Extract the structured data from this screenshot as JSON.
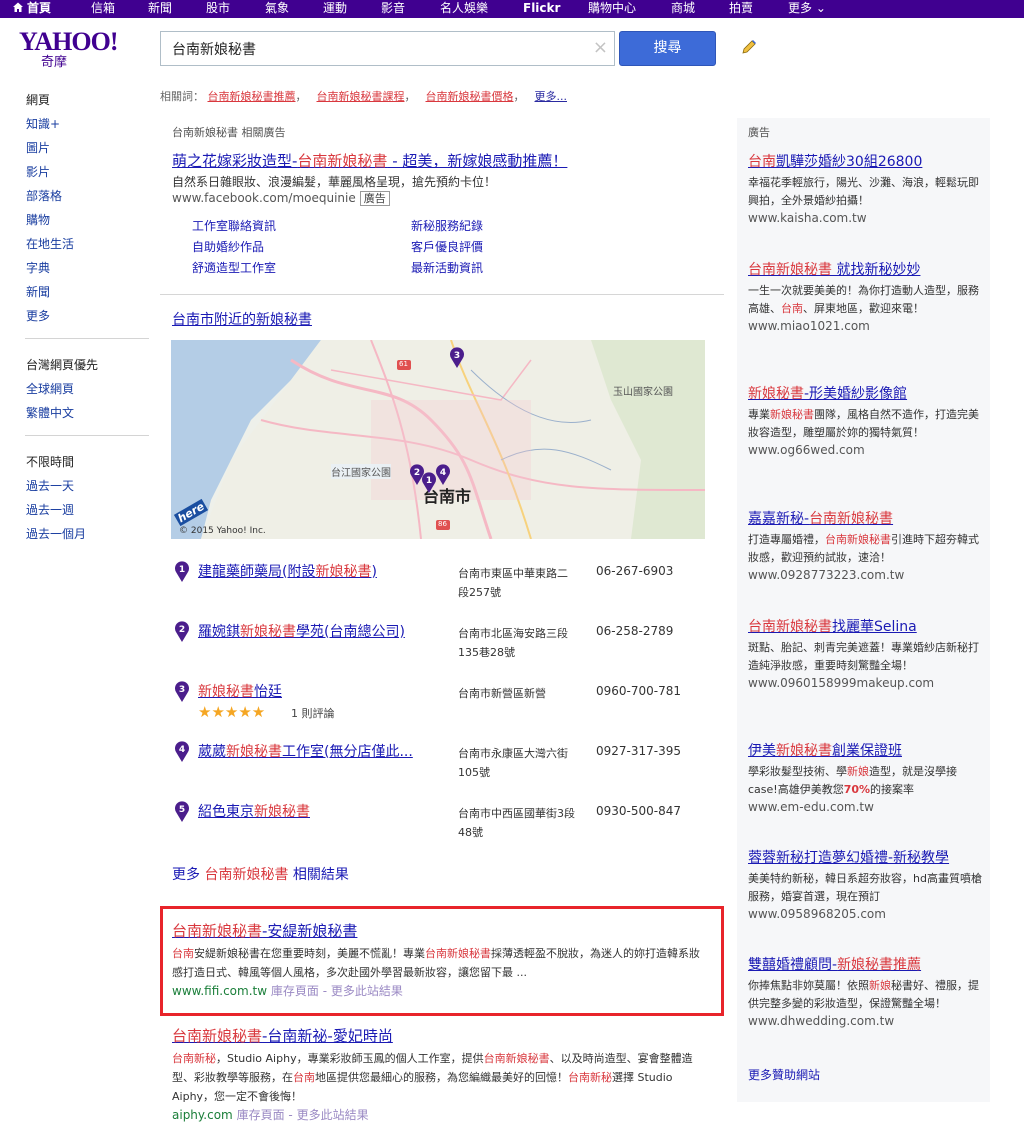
{
  "topnav": [
    {
      "label": "首頁",
      "bold": true,
      "home": true
    },
    {
      "label": "信箱"
    },
    {
      "label": "新聞"
    },
    {
      "label": "股市"
    },
    {
      "label": "氣象"
    },
    {
      "label": "運動"
    },
    {
      "label": "影音"
    },
    {
      "label": "名人娛樂"
    },
    {
      "label": "Flickr",
      "bold": true
    },
    {
      "label": "購物中心"
    },
    {
      "label": "商城"
    },
    {
      "label": "拍賣"
    },
    {
      "label": "更多"
    }
  ],
  "logo": {
    "main": "YAHOO!",
    "sub": "奇摩"
  },
  "search": {
    "value": "台南新娘秘書",
    "button_label": "搜尋",
    "clear_glyph": "×"
  },
  "related": {
    "label": "相關詞：",
    "terms": [
      "台南新娘秘書推薦",
      "台南新娘秘書課程",
      "台南新娘秘書價格"
    ],
    "more": "更多..."
  },
  "sidebar": {
    "group1": [
      "網頁",
      "知識+",
      "圖片",
      "影片",
      "部落格",
      "購物",
      "在地生活",
      "字典",
      "新聞",
      "更多"
    ],
    "group2": [
      "台灣網頁優先",
      "全球網頁",
      "繁體中文"
    ],
    "group3": [
      "不限時間",
      "過去一天",
      "過去一週",
      "過去一個月"
    ]
  },
  "main_ad": {
    "header": "台南新娘秘書 相關廣告",
    "title_pre": "萌之花嫁彩妝造型-",
    "title_hl": "台南新娘秘書",
    "title_post": " - 超美，新嫁娘感動推薦！",
    "desc": "自然系日雜眼妝、浪漫編髮，華麗風格呈現，搶先預約卡位！",
    "url": "www.facebook.com/moequinie",
    "badge": "廣告",
    "sublinks": [
      "工作室聯絡資訊",
      "新秘服務紀錄",
      "自助婚紗作品",
      "客戶優良評價",
      "舒適造型工作室",
      "最新活動資訊"
    ]
  },
  "local": {
    "heading": "台南市附近的新娘秘書",
    "map": {
      "city_label": "台南市",
      "park_label": "玉山國家公園",
      "coast_label": "台江國家公園",
      "credit": "© 2015 Yahoo! Inc.",
      "brand": "here",
      "route_61": "61",
      "route_86": "86"
    },
    "items": [
      {
        "num": "1",
        "name_pre": "建龍藥師藥局(附設",
        "name_hl": "新娘秘書",
        "name_post": ")",
        "addr": "台南市東區中華東路二段257號",
        "phone": "06-267-6903"
      },
      {
        "num": "2",
        "name_pre": "羅婉錤",
        "name_hl": "新娘秘書",
        "name_post": "學苑(台南總公司)",
        "addr": "台南市北區海安路三段135巷28號",
        "phone": "06-258-2789"
      },
      {
        "num": "3",
        "name_pre": "",
        "name_hl": "新娘秘書",
        "name_post": "怡廷",
        "addr": "台南市新營區新營",
        "phone": "0960-700-781",
        "stars": "★★★★★",
        "reviews": "1 則評論"
      },
      {
        "num": "4",
        "name_pre": "葳葳",
        "name_hl": "新娘秘書",
        "name_post": "工作室(無分店僅此...",
        "addr": "台南市永康區大灣六街105號",
        "phone": "0927-317-395"
      },
      {
        "num": "5",
        "name_pre": "紹色東京",
        "name_hl": "新娘秘書",
        "name_post": "",
        "addr": "台南市中西區國華街3段48號",
        "phone": "0930-500-847"
      }
    ],
    "more_pre": "更多 ",
    "more_hl": "台南新娘秘書",
    "more_post": " 相關結果"
  },
  "results": [
    {
      "title_pre": "",
      "title_hl": "台南新娘秘書",
      "title_post": "-安緹新娘秘書",
      "desc_html_parts": [
        {
          "t": "台南",
          "h": true
        },
        {
          "t": "安緹新娘秘書在您重要時刻，美麗不慌亂！專業"
        },
        {
          "t": "台南新娘秘書",
          "h": true
        },
        {
          "t": "採薄透輕盈不脫妝，為迷人的妳打造韓系妝感打造日式、韓風等個人風格，多次赴國外學習最新妝容，讓您留下最 ..."
        }
      ],
      "url": "www.fifi.com.tw",
      "cache": "庫存頁面",
      "more_site": "更多此站結果"
    },
    {
      "title_pre": "",
      "title_hl": "台南新娘秘書",
      "title_post": "-台南新祕-愛妃時尚",
      "desc_html_parts": [
        {
          "t": "台南新秘",
          "h": true
        },
        {
          "t": "，Studio Aiphy，專業彩妝師玉鳳的個人工作室，提供"
        },
        {
          "t": "台南新娘秘書",
          "h": true
        },
        {
          "t": "、以及時尚造型、宴會整體造型、彩妝教學等服務，在"
        },
        {
          "t": "台南",
          "h": true
        },
        {
          "t": "地區提供您最細心的服務，為您編織最美好的回憶！"
        },
        {
          "t": "台南新秘",
          "h": true
        },
        {
          "t": "選擇 Studio Aiphy，您一定不會後悔！"
        }
      ],
      "url": "aiphy.com",
      "cache": "庫存頁面",
      "more_site": "更多此站結果"
    }
  ],
  "right_ads": {
    "label": "廣告",
    "items": [
      {
        "title_pre": "",
        "title_hl": "台南",
        "title_post": "凱驊莎婚紗30組26800",
        "desc": "幸福花季輕旅行，陽光、沙灘、海浪，輕鬆玩即興拍，全外景婚紗拍攝！",
        "url": "www.kaisha.com.tw"
      },
      {
        "title_pre": "",
        "title_hl": "台南新娘秘書",
        "title_post": " 就找新秘妙妙",
        "desc_parts": [
          {
            "t": "一生一次就要美美的！為你打造動人造型，服務高雄、"
          },
          {
            "t": "台南",
            "h": true
          },
          {
            "t": "、屏東地區，歡迎來電！"
          }
        ],
        "url": "www.miao1021.com"
      },
      {
        "title_pre": "",
        "title_hl": "新娘秘書",
        "title_post": "-形美婚紗影像館",
        "desc_parts": [
          {
            "t": "專業"
          },
          {
            "t": "新娘秘書",
            "h": true
          },
          {
            "t": "團隊，風格自然不造作，打造完美妝容造型，雕塑屬於妳的獨特氣質！"
          }
        ],
        "url": "www.og66wed.com"
      },
      {
        "title_pre": "嘉嘉新秘-",
        "title_hl": "台南新娘秘書",
        "title_post": "",
        "desc_parts": [
          {
            "t": "打造專屬婚禮，"
          },
          {
            "t": "台南新娘秘書",
            "h": true
          },
          {
            "t": "引進時下超夯韓式妝感，歡迎預約試妝，速洽！"
          }
        ],
        "url": "www.0928773223.com.tw"
      },
      {
        "title_pre": "",
        "title_hl": "台南新娘秘書",
        "title_post": "找麗華Selina",
        "desc": "斑點、胎記、刺青完美遮蓋！專業婚紗店新秘打造純淨妝感，重要時刻驚豔全場！",
        "url": "www.0960158999makeup.com"
      },
      {
        "title_pre": "伊美",
        "title_hl": "新娘秘書",
        "title_post": "創業保證班",
        "desc_parts": [
          {
            "t": "學彩妝髮型技術、學"
          },
          {
            "t": "新娘",
            "h": true
          },
          {
            "t": "造型，就是沒學接case!高雄伊美教您"
          },
          {
            "t": "70%",
            "h": true,
            "b": true
          },
          {
            "t": "的接案率"
          }
        ],
        "url": "www.em-edu.com.tw"
      },
      {
        "title_pre": "蓉蓉新秘打造夢幻婚禮-新秘教學",
        "title_hl": "",
        "title_post": "",
        "desc": "美美特約新秘，韓日系超夯妝容，hd高畫質噴槍服務，婚宴首選，現在預訂",
        "url": "www.0958968205.com"
      },
      {
        "title_pre": "雙囍婚禮顧問-",
        "title_hl": "新娘秘書推薦",
        "title_post": "",
        "desc_parts": [
          {
            "t": "你捧焦點非妳莫屬！依照"
          },
          {
            "t": "新娘",
            "h": true
          },
          {
            "t": "秘書好、禮服，提供完整多變的彩妝造型，保證驚豔全場！"
          }
        ],
        "url": "www.dhwedding.com.tw"
      }
    ],
    "more": "更多贊助網站"
  }
}
